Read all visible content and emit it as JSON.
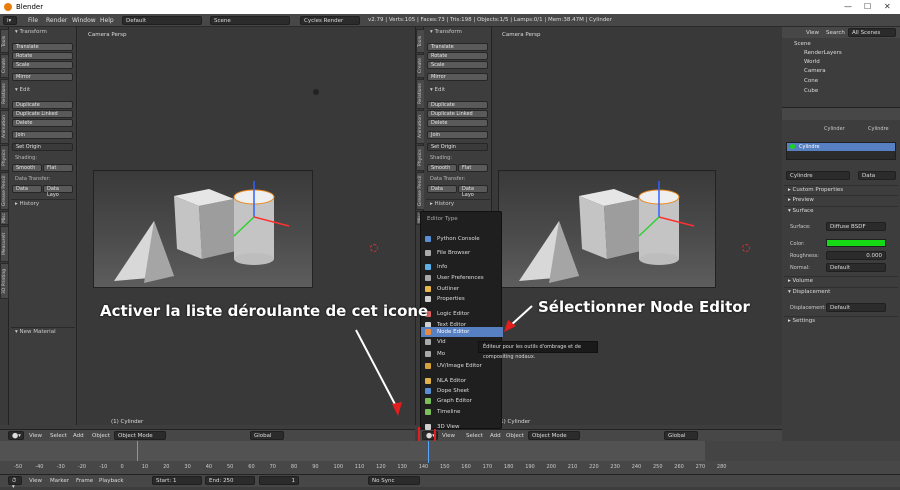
{
  "window": {
    "title": "Blender"
  },
  "menubar": {
    "items": [
      "File",
      "Render",
      "Window",
      "Help"
    ],
    "layout": "Default",
    "scene": "Scene",
    "engine": "Cycles Render",
    "stats": "v2.79 | Verts:105 | Faces:73 | Tris:198 | Objects:1/5 | Lamps:0/1 | Mem:38.47M | Cylinder"
  },
  "tool_tabs": [
    "Tools",
    "Create",
    "Relations",
    "Animation",
    "Physics",
    "Grease Pencil",
    "Misc",
    "MeasureIt",
    "3D Printing"
  ],
  "tool_tabs_right": [
    "Tools",
    "Create",
    "Relations",
    "Animation",
    "Physics",
    "Grease Pencil",
    "Misc"
  ],
  "tools": {
    "transform": "Transform",
    "translate": "Translate",
    "rotate": "Rotate",
    "scale": "Scale",
    "mirror": "Mirror",
    "edit": "Edit",
    "duplicate": "Duplicate",
    "duplicate_linked": "Duplicate Linked",
    "delete": "Delete",
    "join": "Join",
    "set_origin": "Set Origin",
    "shading": "Shading:",
    "smooth": "Smooth",
    "flat": "Flat",
    "data_transfer": "Data Transfer:",
    "data": "Data",
    "data_layo": "Data Layo",
    "history": "History",
    "new_material": "New Material"
  },
  "viewport": {
    "label": "Camera Persp",
    "object": "(1) Cylinder"
  },
  "header": {
    "view": "View",
    "select": "Select",
    "add": "Add",
    "object": "Object",
    "mode": "Object Mode",
    "orientation": "Global"
  },
  "timeline": {
    "view": "View",
    "marker": "Marker",
    "frame": "Frame",
    "playback": "Playback",
    "start_label": "Start:",
    "start": "1",
    "end_label": "End:",
    "end": "250",
    "current": "1",
    "sync": "No Sync",
    "ticks": [
      "-50",
      "-40",
      "-30",
      "-20",
      "-10",
      "0",
      "10",
      "20",
      "30",
      "40",
      "50",
      "60",
      "70",
      "80",
      "90",
      "100",
      "110",
      "120",
      "130",
      "140",
      "150",
      "160",
      "170",
      "180",
      "190",
      "200",
      "210",
      "220",
      "230",
      "240",
      "250",
      "260",
      "270",
      "280"
    ]
  },
  "outliner": {
    "view": "View",
    "search": "Search",
    "filter": "All Scenes",
    "items": [
      "Scene",
      "RenderLayers",
      "World",
      "Camera",
      "Cone",
      "Cube"
    ]
  },
  "properties": {
    "obj1": "Cylinder",
    "obj2": "Cylindre",
    "material": "Cylindre",
    "data": "Data",
    "custom": "Custom Properties",
    "preview": "Preview",
    "surface": "Surface",
    "surface_label": "Surface:",
    "surface_value": "Diffuse BSDF",
    "color_label": "Color:",
    "roughness_label": "Roughness:",
    "roughness": "0.000",
    "normal_label": "Normal:",
    "normal": "Default",
    "volume": "Volume",
    "displacement": "Displacement",
    "disp_label": "Displacement:",
    "disp_value": "Default",
    "settings": "Settings"
  },
  "editor_menu": {
    "title": "Editor Type",
    "items": [
      "Python Console",
      "File Browser",
      "Info",
      "User Preferences",
      "Outliner",
      "Properties",
      "Logic Editor",
      "Text Editor",
      "Node Editor",
      "Vid",
      "Mo",
      "UV/Image Editor",
      "NLA Editor",
      "Dope Sheet",
      "Graph Editor",
      "Timeline",
      "3D View"
    ],
    "selected": "Node Editor",
    "tooltip": "Éditeur pour les outils d'ombrage et de compositing nodaux."
  },
  "annotations": {
    "left": "Activer la liste déroulante de cet icone",
    "right": "Sélectionner Node Editor"
  },
  "colors": {
    "accent": "#5680c2",
    "highlight": "#e31e1e",
    "green": "#16d916"
  }
}
